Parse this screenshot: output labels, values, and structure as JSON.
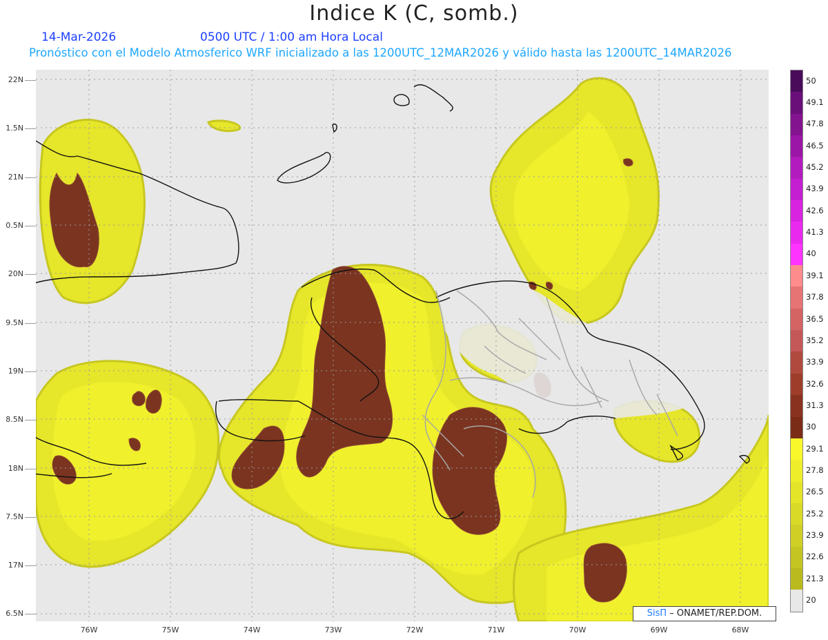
{
  "title": "Indice K (C, somb.)",
  "date": "14-Mar-2026",
  "time": "0500 UTC / 1:00 am Hora Local",
  "forecast_line": "Pronóstico con el Modelo Atmosferico WRF inicializado a las 1200UTC_12MAR2026 y válido hasta las  1200UTC_14MAR2026",
  "lat_labels": [
    "22N",
    "1.5N",
    "21N",
    "0.5N",
    "20N",
    "9.5N",
    "19N",
    "8.5N",
    "18N",
    "7.5N",
    "17N",
    "6.5N"
  ],
  "lon_labels": [
    "76W",
    "75W",
    "74W",
    "73W",
    "72W",
    "71W",
    "70W",
    "69W",
    "68W"
  ],
  "colorbar": {
    "labels": [
      "50",
      "49.1",
      "47.8",
      "46.5",
      "45.2",
      "43.9",
      "42.6",
      "41.3",
      "40",
      "39.1",
      "37.8",
      "36.5",
      "35.2",
      "33.9",
      "32.6",
      "31.3",
      "30",
      "29.1",
      "27.8",
      "26.5",
      "25.2",
      "23.9",
      "22.6",
      "21.3",
      "20"
    ],
    "colors": [
      "#4a0b5a",
      "#6a0f7a",
      "#83138f",
      "#9b16a6",
      "#b21bbd",
      "#c41fd0",
      "#d823e0",
      "#ea29ef",
      "#ff33ff",
      "#ff8c8c",
      "#e67474",
      "#d46464",
      "#c45858",
      "#b04a3e",
      "#9e3e2a",
      "#8a3220",
      "#7a2c16",
      "#f8f82a",
      "#eeee2a",
      "#e4e429",
      "#d9d927",
      "#cfcf25",
      "#c4c422",
      "#baba1f",
      "#e8e8e8"
    ]
  },
  "credit": {
    "brand": "SisΠ",
    "text": "– ONAMET/REP.DOM."
  },
  "colors": {
    "yellow": "#f2f22a",
    "olive": "#c7c720",
    "brown": "#7a3420"
  }
}
